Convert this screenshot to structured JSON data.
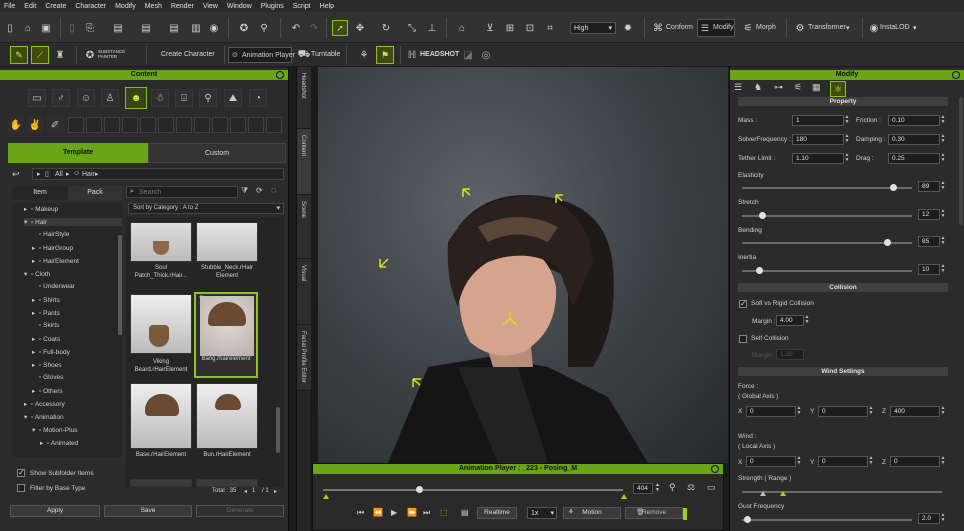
{
  "menu": [
    "File",
    "Edit",
    "Create",
    "Character",
    "Modify",
    "Mesh",
    "Render",
    "View",
    "Window",
    "Plugins",
    "Script",
    "Help"
  ],
  "toolbar": {
    "quality": "High",
    "conform": "Conform",
    "modify": "Modify",
    "morph": "Morph",
    "transformer": "Transformer",
    "instalod": "InstaLOD"
  },
  "toolbar2": {
    "substance": "SUBSTANCE\nPAINTER",
    "create_character": "Create Character",
    "animation_player": "Animation Player",
    "turntable": "Turntable",
    "headshot": "HEADSHOT"
  },
  "content": {
    "title": "Content",
    "tab_template": "Template",
    "tab_custom": "Custom",
    "breadcrumb": [
      "All",
      "Hair"
    ],
    "subtab_item": "Item",
    "subtab_pack": "Pack",
    "search_placeholder": "Search",
    "sort": "Sort by Category : A to Z",
    "tree": [
      {
        "label": "Makeup",
        "indent": 1,
        "arrow": "▸"
      },
      {
        "label": "Hair",
        "indent": 1,
        "arrow": "▾",
        "selected": true
      },
      {
        "label": "HairStyle",
        "indent": 2,
        "arrow": ""
      },
      {
        "label": "HairGroup",
        "indent": 2,
        "arrow": "▸"
      },
      {
        "label": "HairElement",
        "indent": 2,
        "arrow": "▸"
      },
      {
        "label": "Cloth",
        "indent": 1,
        "arrow": "▾"
      },
      {
        "label": "Underwear",
        "indent": 2,
        "arrow": ""
      },
      {
        "label": "Shirts",
        "indent": 2,
        "arrow": "▸"
      },
      {
        "label": "Pants",
        "indent": 2,
        "arrow": "▸"
      },
      {
        "label": "Skirts",
        "indent": 2,
        "arrow": ""
      },
      {
        "label": "Coats",
        "indent": 2,
        "arrow": "▸"
      },
      {
        "label": "Full-body",
        "indent": 2,
        "arrow": "▸"
      },
      {
        "label": "Shoes",
        "indent": 2,
        "arrow": "▸"
      },
      {
        "label": "Gloves",
        "indent": 2,
        "arrow": ""
      },
      {
        "label": "Others",
        "indent": 2,
        "arrow": "▸"
      },
      {
        "label": "Accessory",
        "indent": 1,
        "arrow": "▸"
      },
      {
        "label": "Animation",
        "indent": 1,
        "arrow": "▾"
      },
      {
        "label": "Motion-Plus",
        "indent": 2,
        "arrow": "▾"
      },
      {
        "label": "Animated",
        "indent": 3,
        "arrow": "▸"
      }
    ],
    "items": [
      {
        "label": "Soul\nPatch_Thick.rHair..."
      },
      {
        "label": "Stubble_Neck.rHair\nElement"
      },
      {
        "label": "Viking\nBeard.rHairElement"
      },
      {
        "label": "Bang.rhairelement",
        "selected": true
      },
      {
        "label": "Base.rHairElement"
      },
      {
        "label": "Bun.rHairElement"
      }
    ],
    "total": "Total : 35",
    "page": "1",
    "pages": "/ 1",
    "show_subfolder": "Show Subfolder Items",
    "filter_base": "Filter by Base Type",
    "apply": "Apply",
    "save": "Save",
    "generate": "Generate"
  },
  "sidetabs": [
    "Headshot",
    "Content",
    "Scene",
    "Visual",
    "Facial Profile Editor"
  ],
  "anim": {
    "title": "Animation Player : _223 - Posing_M",
    "frame": "404",
    "realtime": "Realtime",
    "speed": "1x",
    "motion": "Motion",
    "remove": "Remove",
    "progress": 0.32
  },
  "modify": {
    "title": "Modify",
    "section_property": "Property",
    "mass_label": "Mass :",
    "mass": "1",
    "friction_label": "Friction :",
    "friction": "0.10",
    "solver_label": "SolverFrequency :",
    "solver": "180",
    "damping_label": "Damping :",
    "damping": "0.30",
    "tether_label": "Tether Limit :",
    "tether": "1.10",
    "drag_label": "Drag :",
    "drag": "0.25",
    "elasticity_label": "Elasticity",
    "elasticity": "89",
    "stretch_label": "Stretch",
    "stretch": "12",
    "bending_label": "Bending",
    "bending": "85",
    "inertia_label": "Inertia",
    "inertia": "10",
    "section_collision": "Collision",
    "soft_rigid": "Soft vs Rigid Collision",
    "margin_label": "Margin :",
    "margin": "4.00",
    "self_collision": "Self Collision",
    "margin2": "1.20",
    "section_wind": "Wind Settings",
    "force_label": "Force :",
    "force_axis": "( Global Axis )",
    "force_x": "0",
    "force_y": "0",
    "force_z": "400",
    "wind_label": "Wind :",
    "wind_axis": "( Local Axis )",
    "wind_x": "0",
    "wind_y": "0",
    "wind_z": "0",
    "strength_label": "Strength ( Range )",
    "gust_label": "Gust Frequency",
    "gust": "2.0",
    "x": "X",
    "y": "Y",
    "z": "Z"
  }
}
